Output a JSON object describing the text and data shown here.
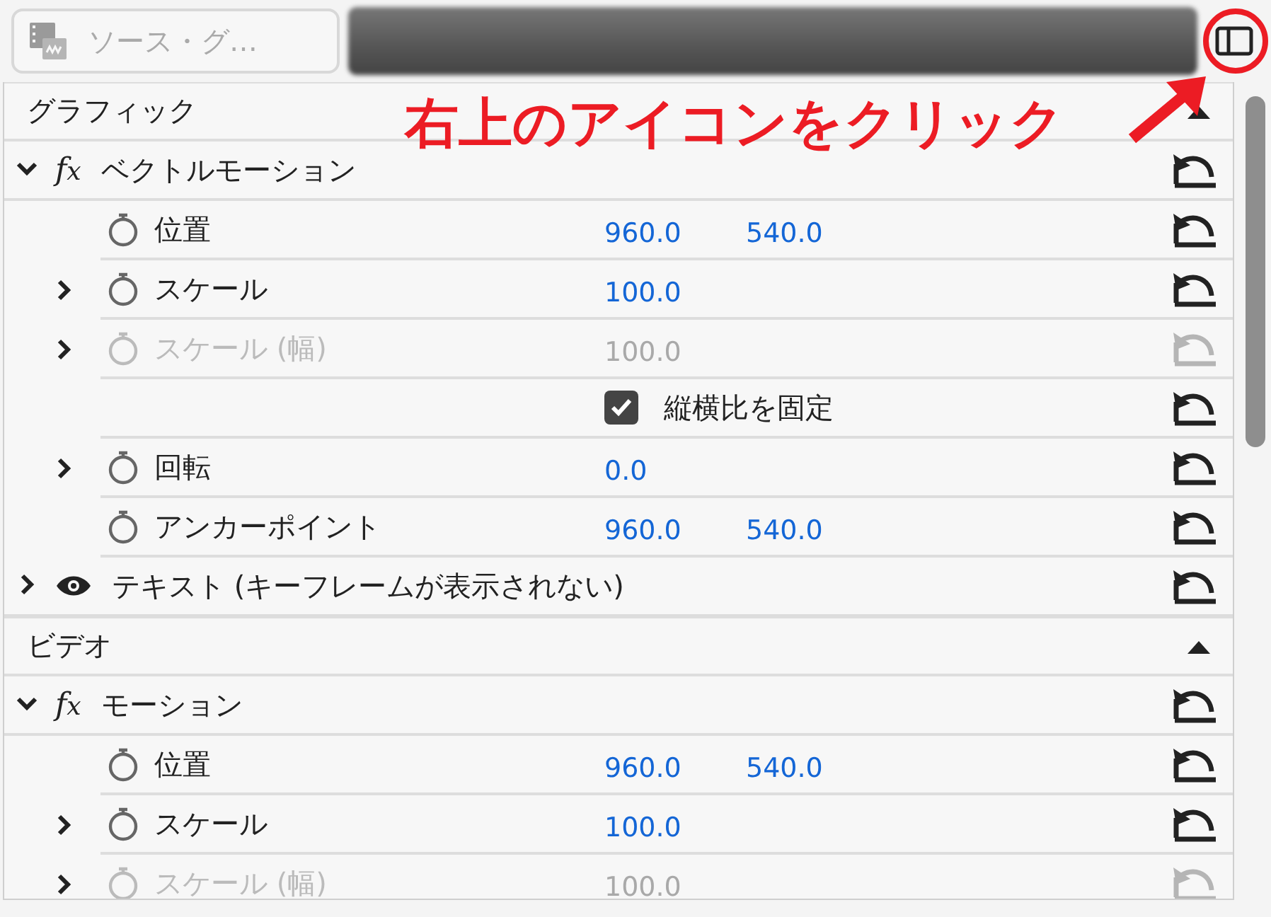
{
  "source_selector": {
    "label": "ソース・グ…",
    "disabled": true
  },
  "annotation": {
    "text": "右上のアイコンをクリック"
  },
  "sections": [
    {
      "title": "グラフィック",
      "expanded": true,
      "effects": [
        {
          "name": "ベクトルモーション",
          "kind": "fx",
          "expanded": true,
          "params": [
            {
              "kind": "param",
              "name": "位置",
              "values": [
                "960.0",
                "540.0"
              ],
              "expandable": false,
              "disabled": false
            },
            {
              "kind": "param",
              "name": "スケール",
              "values": [
                "100.0"
              ],
              "expandable": true,
              "disabled": false
            },
            {
              "kind": "param",
              "name": "スケール (幅)",
              "values": [
                "100.0"
              ],
              "expandable": true,
              "disabled": true
            },
            {
              "kind": "checkbox",
              "label": "縦横比を固定",
              "checked": true
            },
            {
              "kind": "param",
              "name": "回転",
              "values": [
                "0.0"
              ],
              "expandable": true,
              "disabled": false
            },
            {
              "kind": "param",
              "name": "アンカーポイント",
              "values": [
                "960.0",
                "540.0"
              ],
              "expandable": false,
              "disabled": false
            }
          ]
        },
        {
          "name": "テキスト (キーフレームが表示されない)",
          "kind": "eye",
          "expanded": false
        }
      ]
    },
    {
      "title": "ビデオ",
      "expanded": true,
      "effects": [
        {
          "name": "モーション",
          "kind": "fx",
          "expanded": true,
          "params": [
            {
              "kind": "param",
              "name": "位置",
              "values": [
                "960.0",
                "540.0"
              ],
              "expandable": false,
              "disabled": false
            },
            {
              "kind": "param",
              "name": "スケール",
              "values": [
                "100.0"
              ],
              "expandable": true,
              "disabled": false
            },
            {
              "kind": "param",
              "name": "スケール (幅)",
              "values": [
                "100.0"
              ],
              "expandable": true,
              "disabled": true
            }
          ]
        }
      ]
    }
  ]
}
